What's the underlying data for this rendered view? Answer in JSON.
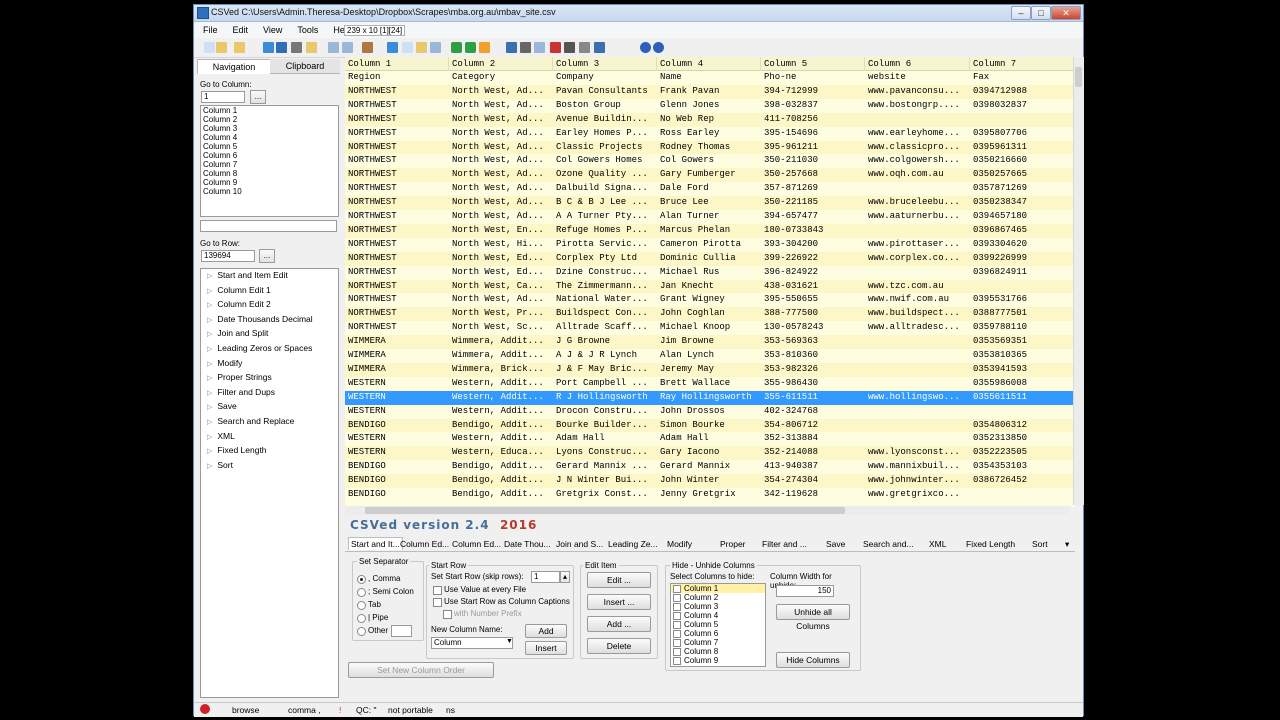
{
  "window": {
    "title": "CSVed C:\\Users\\Admin.Theresa-Desktop\\Dropbox\\Scrapes\\mba.org.au\\mbav_site.csv",
    "minimize": "–",
    "maximize": "□",
    "close": "✕"
  },
  "menu": {
    "items": [
      "File",
      "Edit",
      "View",
      "Tools",
      "Help"
    ],
    "info": "239 x 10 [1][24]"
  },
  "toolbar": {
    "icons": [
      "new-icon",
      "open-icon",
      "open-recent-icon",
      "reload-icon",
      "save-icon",
      "print-icon",
      "folder-icon",
      "window-icon",
      "window2-icon",
      "book-icon",
      "undo-icon",
      "copy-icon",
      "paste-icon",
      "table-icon",
      "checkmark-icon",
      "checkbox-icon",
      "highlight-icon",
      "font-icon",
      "find-icon",
      "column-icon",
      "delete-icon",
      "cut-icon",
      "gear-icon",
      "grid-icon",
      "info-icon",
      "help-icon"
    ],
    "colors": [
      "#cfe0f5",
      "#e8c86a",
      "#e8c86a",
      "#3a8bd8",
      "#2f6db8",
      "#777777",
      "#e8c86a",
      "#9ab6d8",
      "#9ab6d8",
      "#b07840",
      "#3a8bd8",
      "#cfe0f5",
      "#e8c86a",
      "#9ab6d8",
      "#2ea043",
      "#2ea043",
      "#f2a02c",
      "#3a6fb0",
      "#666666",
      "#9ab6d8",
      "#cc3333",
      "#555555",
      "#888888",
      "#3a6fb0",
      "#2f5fb8",
      "#2f5fb8"
    ]
  },
  "left_panel": {
    "tabs": [
      "Navigation",
      "Clipboard"
    ],
    "goto_column_label": "Go to Column:",
    "goto_column_value": "1",
    "browse_label": "...",
    "columns": [
      "Column 1",
      "Column 2",
      "Column 3",
      "Column 4",
      "Column 5",
      "Column 6",
      "Column 7",
      "Column 8",
      "Column 9",
      "Column 10"
    ],
    "goto_row_label": "Go to Row:",
    "goto_row_value": "139694",
    "tree": [
      "Start and Item Edit",
      "Column Edit 1",
      "Column Edit 2",
      "Date Thousands Decimal",
      "Join and Split",
      "Leading Zeros or Spaces",
      "Modify",
      "Proper Strings",
      "Filter and Dups",
      "Save",
      "Search and Replace",
      "XML",
      "Fixed Length",
      "Sort"
    ]
  },
  "grid": {
    "headers": [
      "Column 1",
      "Column 2",
      "Column 3",
      "Column 4",
      "Column 5",
      "Column 6",
      "Column 7"
    ],
    "selected_row": 23,
    "rows": [
      [
        "Region",
        "Category",
        "Company",
        "Name",
        "Pho-ne",
        "website",
        "Fax"
      ],
      [
        "NORTHWEST",
        "North West, Ad...",
        "Pavan Consultants",
        "Frank Pavan",
        "394-712999",
        "www.pavanconsu...",
        "0394712988"
      ],
      [
        "NORTHWEST",
        "North West, Ad...",
        "Boston Group",
        "Glenn Jones",
        "398-032837",
        "www.bostongrp....",
        "0398032837"
      ],
      [
        "NORTHWEST",
        "North West, Ad...",
        "Avenue Buildin...",
        "No Web Rep",
        "411-708256",
        "",
        ""
      ],
      [
        "NORTHWEST",
        "North West, Ad...",
        "Earley Homes P...",
        "Ross Earley",
        "395-154696",
        "www.earleyhome...",
        "0395807706"
      ],
      [
        "NORTHWEST",
        "North West, Ad...",
        "Classic Projects",
        "Rodney Thomas",
        "395-961211",
        "www.classicpro...",
        "0395961311"
      ],
      [
        "NORTHWEST",
        "North West, Ad...",
        "Col Gowers Homes",
        "Col Gowers",
        "350-211030",
        "www.colgowersh...",
        "0350216660"
      ],
      [
        "NORTHWEST",
        "North West, Ad...",
        "Ozone Quality ...",
        "Gary Fumberger",
        "350-257668",
        "www.oqh.com.au",
        "0350257665"
      ],
      [
        "NORTHWEST",
        "North West, Ad...",
        "Dalbuild Signa...",
        "Dale Ford",
        "357-871269",
        "",
        "0357871269"
      ],
      [
        "NORTHWEST",
        "North West, Ad...",
        "B C & B J Lee ...",
        "Bruce Lee",
        "350-221185",
        "www.bruceleebu...",
        "0350238347"
      ],
      [
        "NORTHWEST",
        "North West, Ad...",
        "A A Turner Pty...",
        "Alan Turner",
        "394-657477",
        "www.aaturnerbu...",
        "0394657180"
      ],
      [
        "NORTHWEST",
        "North West, En...",
        "Refuge Homes P...",
        "Marcus Phelan",
        "180-0733843",
        "",
        "0396867465"
      ],
      [
        "NORTHWEST",
        "North West, Hi...",
        "Pirotta Servic...",
        "Cameron Pirotta",
        "393-304200",
        "www.pirottaser...",
        "0393304620"
      ],
      [
        "NORTHWEST",
        "North West, Ed...",
        "Corplex Pty Ltd",
        "Dominic Cullia",
        "399-226922",
        "www.corplex.co...",
        "0399226999"
      ],
      [
        "NORTHWEST",
        "North West, Ed...",
        "Dzine Construc...",
        "Michael Rus",
        "396-824922",
        "",
        "0396824911"
      ],
      [
        "NORTHWEST",
        "North West, Ca...",
        "The Zimmermann...",
        "Jan Knecht",
        "438-031621",
        "www.tzc.com.au",
        ""
      ],
      [
        "NORTHWEST",
        "North West, Ad...",
        "National Water...",
        "Grant Wigney",
        "395-550655",
        "www.nwif.com.au",
        "0395531766"
      ],
      [
        "NORTHWEST",
        "North West, Pr...",
        "Buildspect Con...",
        "John Coghlan",
        "388-777500",
        "www.buildspect...",
        "0388777501"
      ],
      [
        "NORTHWEST",
        "North West, Sc...",
        "Alltrade Scaff...",
        "Michael Knoop",
        "130-0578243",
        "www.alltradesc...",
        "0359788110"
      ],
      [
        "WIMMERA",
        "Wimmera, Addit...",
        "J G Browne",
        "Jim Browne",
        "353-569363",
        "",
        "0353569351"
      ],
      [
        "WIMMERA",
        "Wimmera, Addit...",
        "A J & J R Lynch",
        "Alan Lynch",
        "353-810360",
        "",
        "0353810365"
      ],
      [
        "WIMMERA",
        "Wimmera, Brick...",
        "J & F May Bric...",
        "Jeremy May",
        "353-982326",
        "",
        "0353941593"
      ],
      [
        "WESTERN",
        "Western, Addit...",
        "Port Campbell ...",
        "Brett Wallace",
        "355-986430",
        "",
        "0355986008"
      ],
      [
        "WESTERN",
        "Western, Addit...",
        "R J Hollingsworth",
        "Ray Hollingsworth",
        "355-611511",
        "www.hollingswo...",
        "0355611511"
      ],
      [
        "WESTERN",
        "Western, Addit...",
        "Drocon Constru...",
        "John Drossos",
        "402-324768",
        "",
        ""
      ],
      [
        "BENDIGO",
        "Bendigo, Addit...",
        "Bourke Builder...",
        "Simon Bourke",
        "354-806712",
        "",
        "0354806312"
      ],
      [
        "WESTERN",
        "Western, Addit...",
        "Adam Hall",
        "Adam Hall",
        "352-313884",
        "",
        "0352313850"
      ],
      [
        "WESTERN",
        "Western, Educa...",
        "Lyons Construc...",
        "Gary Iacono",
        "352-214088",
        "www.lyonsconst...",
        "0352223505"
      ],
      [
        "BENDIGO",
        "Bendigo, Addit...",
        "Gerard Mannix ...",
        "Gerard Mannix",
        "413-940387",
        "www.mannixbuil...",
        "0354353103"
      ],
      [
        "BENDIGO",
        "Bendigo, Addit...",
        "J N Winter Bui...",
        "John Winter",
        "354-274304",
        "www.johnwinter...",
        "0386726452"
      ],
      [
        "BENDIGO",
        "Bendigo, Addit...",
        "Gretgrix Const...",
        "Jenny Gretgrix",
        "342-119628",
        "www.gretgrixco...",
        ""
      ]
    ]
  },
  "version": {
    "text": "CSVed version 2.4",
    "year": "2016"
  },
  "bottom_tabs": [
    "Start and It...",
    "Column Ed...",
    "Column Ed...",
    "Date Thou...",
    "Join and S...",
    "Leading Ze...",
    "Modify",
    "Proper",
    "Filter and ...",
    "Save",
    "Search and...",
    "XML",
    "Fixed Length",
    "Sort"
  ],
  "bottom": {
    "separator": {
      "title": "Set Separator",
      "options": [
        ", Comma",
        "; Semi Colon",
        "Tab",
        "| Pipe",
        "Other"
      ],
      "selected": 0
    },
    "start_row": {
      "title": "Start Row",
      "skip_label": "Set Start Row (skip rows):",
      "skip_value": "1",
      "use_value_label": "Use Value at every File",
      "use_caption_label": "Use Start Row as Column Captions",
      "prefix_label": "with Number Prefix",
      "new_column_label": "New Column Name:",
      "new_column_value": "Column",
      "add_label": "Add",
      "insert_label": "Insert"
    },
    "edit_item": {
      "title": "Edit Item",
      "edit": "Edit ...",
      "insert": "Insert ...",
      "add": "Add ...",
      "delete": "Delete"
    },
    "hide_unhide": {
      "title": "Hide - Unhide Columns",
      "select_label": "Select Columns to hide:",
      "columns": [
        "Column 1",
        "Column 2",
        "Column 3",
        "Column 4",
        "Column 5",
        "Column 6",
        "Column 7",
        "Column 8",
        "Column 9"
      ],
      "width_label": "Column Width for unhide:",
      "width_value": "150",
      "unhide_all": "Unhide all Columns",
      "hide": "Hide Columns"
    },
    "new_column_order": "Set New Column Order"
  },
  "status": {
    "mode": "browse",
    "separator": "comma ,",
    "qc": "QC: \"",
    "portable": "not portable",
    "ns": "ns"
  }
}
